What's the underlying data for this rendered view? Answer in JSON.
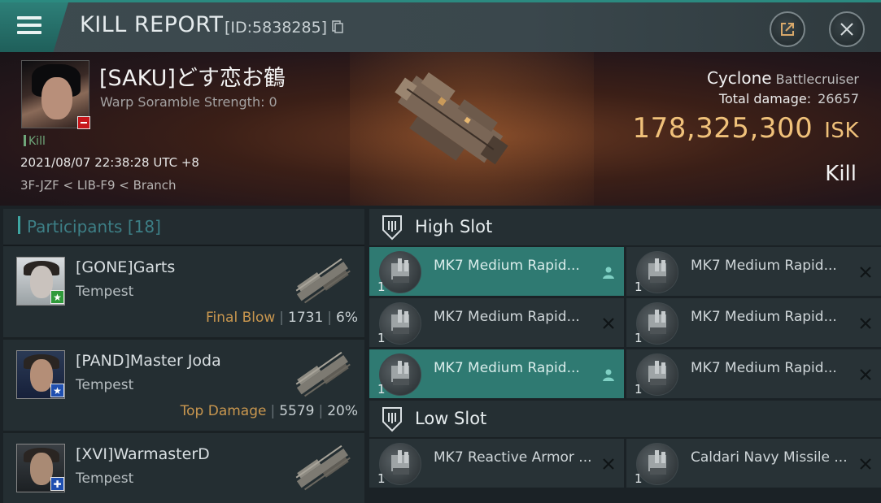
{
  "header": {
    "title": "KILL REPORT",
    "id_label": "[ID:5838285]"
  },
  "victim": {
    "name": "[SAKU]どす恋お鶴",
    "warp_scramble": "Warp Soramble Strength: 0",
    "kill_tag": "Kill",
    "datetime": "2021/08/07 22:38:28 UTC +8",
    "location": "3F-JZF < LIB-F9 < Branch",
    "ship_name": "Cyclone",
    "ship_class": "Battlecruiser",
    "total_damage_label": "Total damage:",
    "total_damage": "26657",
    "isk_value": "178,325,300",
    "isk_unit": "ISK",
    "result": "Kill"
  },
  "participants": {
    "label": "Participants",
    "count": "[18]",
    "rows": [
      {
        "name": "[GONE]Garts",
        "ship": "Tempest",
        "tag": "Final Blow",
        "damage": "1731",
        "percent": "6%",
        "badge": "star",
        "badge_color": "#2f9a3a"
      },
      {
        "name": "[PAND]Master Joda",
        "ship": "Tempest",
        "tag": "Top Damage",
        "damage": "5579",
        "percent": "20%",
        "badge": "star",
        "badge_color": "#1f4fb0"
      },
      {
        "name": "[XVI]WarmasterD",
        "ship": "Tempest",
        "tag": "",
        "damage": "",
        "percent": "",
        "badge": "plus",
        "badge_color": "#1f4fb0"
      }
    ]
  },
  "high_slot": {
    "label": "High Slot",
    "modules": [
      {
        "qty": "1",
        "name": "MK7 Medium Rapid...",
        "highlight": true,
        "action": "person"
      },
      {
        "qty": "1",
        "name": "MK7 Medium Rapid...",
        "highlight": false,
        "action": "close"
      },
      {
        "qty": "1",
        "name": "MK7 Medium Rapid...",
        "highlight": false,
        "action": "close"
      },
      {
        "qty": "1",
        "name": "MK7 Medium Rapid...",
        "highlight": false,
        "action": "close"
      },
      {
        "qty": "1",
        "name": "MK7 Medium Rapid...",
        "highlight": true,
        "action": "person"
      },
      {
        "qty": "1",
        "name": "MK7 Medium Rapid...",
        "highlight": false,
        "action": "close"
      }
    ]
  },
  "low_slot": {
    "label": "Low Slot",
    "modules": [
      {
        "qty": "1",
        "name": "MK7 Reactive Armor ...",
        "highlight": false,
        "action": "close"
      },
      {
        "qty": "1",
        "name": "Caldari Navy Missile ...",
        "highlight": false,
        "action": "close"
      }
    ]
  },
  "colors": {
    "accent": "#2f7a72",
    "isk": "#f0c17a",
    "tag": "#c9974f"
  }
}
